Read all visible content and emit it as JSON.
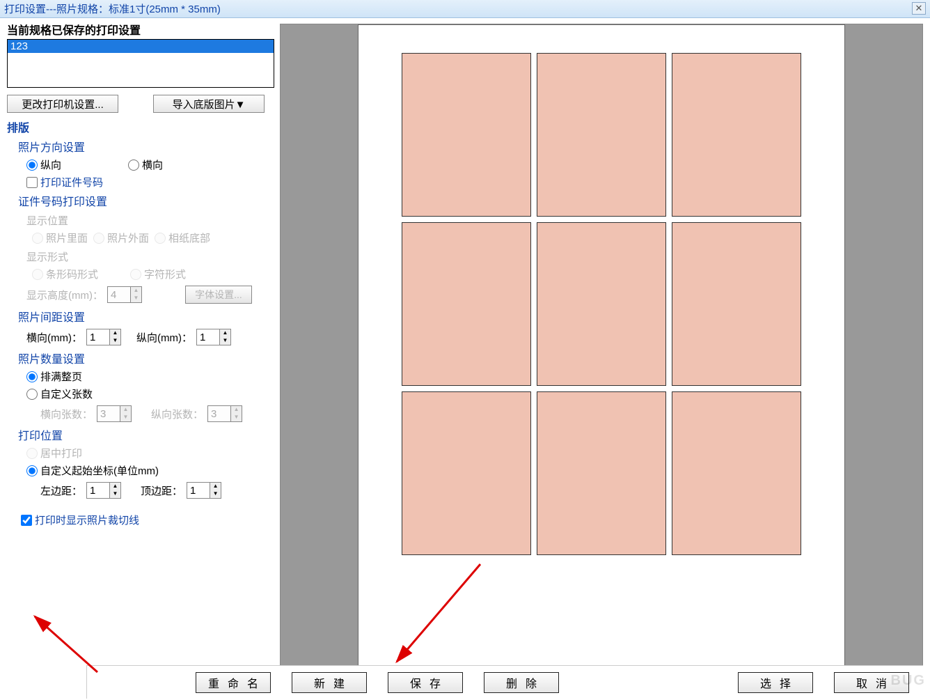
{
  "titlebar": {
    "title": "打印设置---照片规格：标准1寸(25mm * 35mm)"
  },
  "saved_settings": {
    "label": "当前规格已保存的打印设置",
    "items": [
      "123"
    ]
  },
  "buttons": {
    "printer_settings": "更改打印机设置...",
    "import_base_image": "导入底版图片▼",
    "font_settings": "字体设置..."
  },
  "layout": {
    "group_label": "排版",
    "orientation": {
      "label": "照片方向设置",
      "portrait": "纵向",
      "landscape": "横向",
      "selected": "portrait"
    },
    "print_cert_number": {
      "label": "打印证件号码",
      "checked": false
    },
    "cert_number_settings": {
      "label": "证件号码打印设置",
      "display_position": {
        "label": "显示位置",
        "opt1": "照片里面",
        "opt2": "照片外面",
        "opt3": "相纸底部"
      },
      "display_form": {
        "label": "显示形式",
        "opt1": "条形码形式",
        "opt2": "字符形式"
      },
      "display_height": {
        "label": "显示高度(mm)：",
        "value": "4"
      }
    },
    "spacing": {
      "label": "照片间距设置",
      "h_label": "横向(mm)：",
      "h_value": "1",
      "v_label": "纵向(mm)：",
      "v_value": "1"
    },
    "quantity": {
      "label": "照片数量设置",
      "full_page": "排满整页",
      "custom": "自定义张数",
      "h_count_label": "横向张数：",
      "h_count": "3",
      "v_count_label": "纵向张数：",
      "v_count": "3",
      "selected": "full_page"
    },
    "position": {
      "label": "打印位置",
      "center": "居中打印",
      "custom": "自定义起始坐标(单位mm)",
      "left_label": "左边距：",
      "left_value": "1",
      "top_label": "顶边距：",
      "top_value": "1",
      "selected": "custom"
    },
    "show_cut_lines": {
      "label": "打印时显示照片裁切线",
      "checked": true
    }
  },
  "bottom_buttons": {
    "rename": "重命名",
    "new": "新建",
    "save": "保存",
    "delete": "删除",
    "select": "选择",
    "cancel": "取消"
  },
  "watermark": "BUG"
}
